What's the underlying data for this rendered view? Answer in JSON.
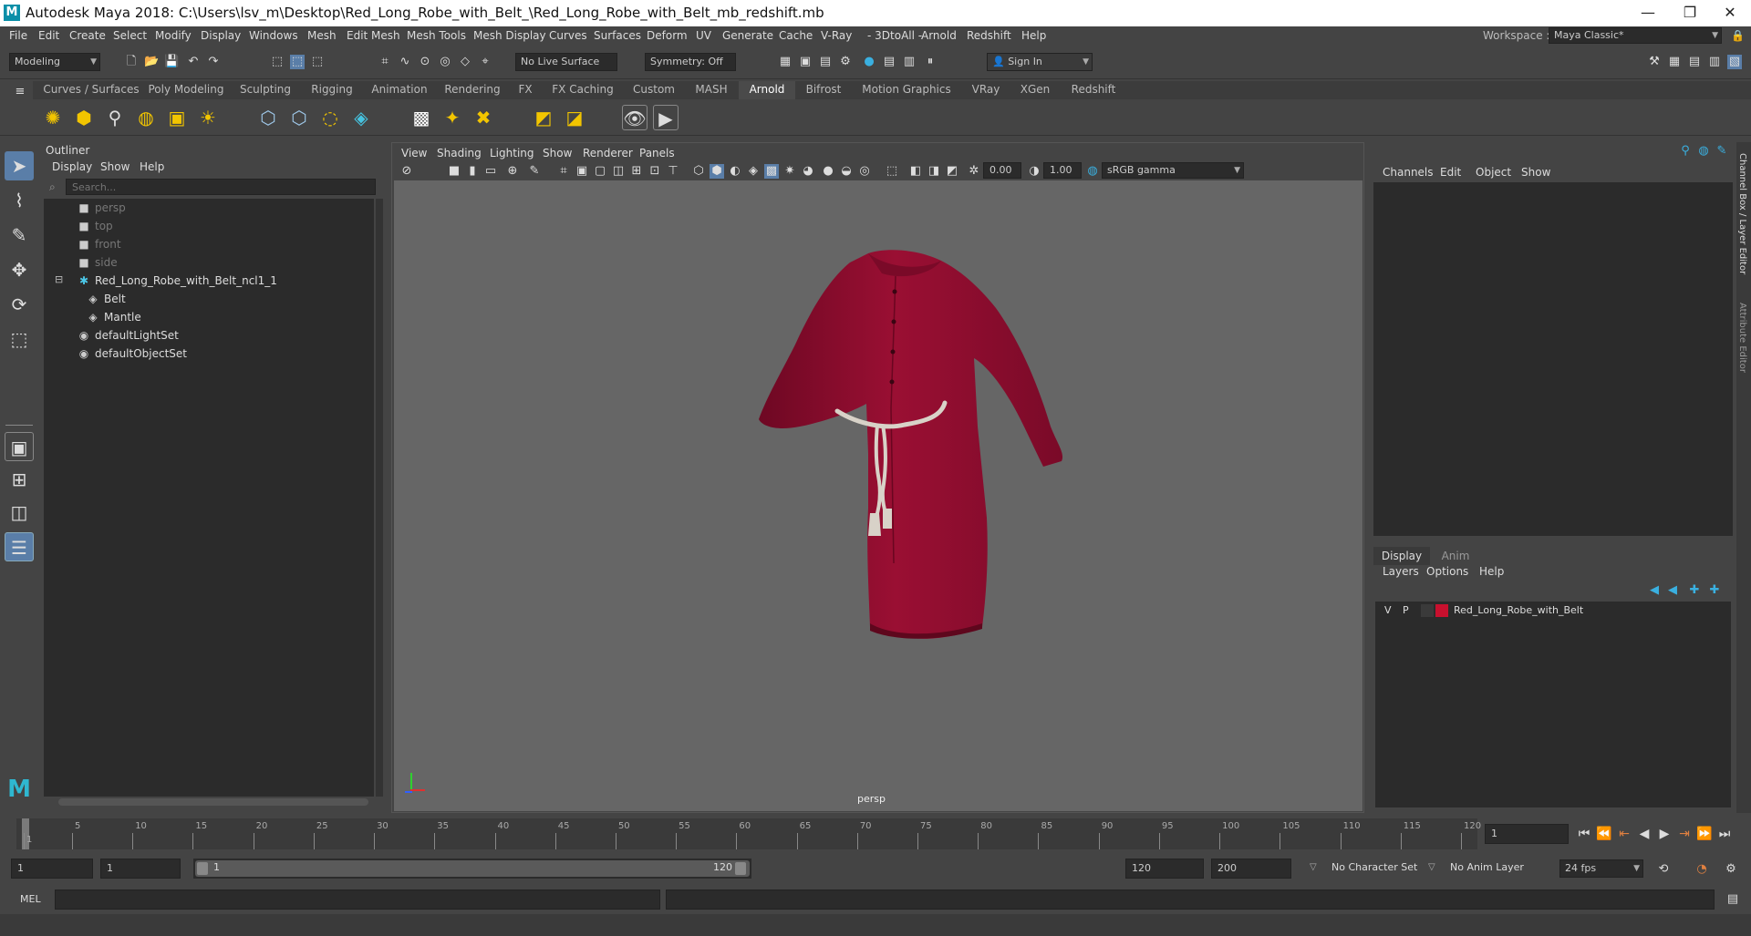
{
  "window": {
    "title": "Autodesk Maya 2018: C:\\Users\\lsv_m\\Desktop\\Red_Long_Robe_with_Belt_\\Red_Long_Robe_with_Belt_mb_redshift.mb",
    "logo_letter": "M",
    "minimize": "—",
    "maximize": "❐",
    "close": "✕"
  },
  "menubar": [
    "File",
    "Edit",
    "Create",
    "Select",
    "Modify",
    "Display",
    "Windows",
    "Mesh",
    "Edit Mesh",
    "Mesh Tools",
    "Mesh Display",
    "Curves",
    "Surfaces",
    "Deform",
    "UV",
    "Generate",
    "Cache",
    "V-Ray",
    "- 3DtoAll -",
    "Arnold",
    "Redshift",
    "Help"
  ],
  "workspace": {
    "label": "Workspace :",
    "value": "Maya Classic*"
  },
  "statusline": {
    "mode": "Modeling",
    "live_surface": "No Live Surface",
    "symmetry": "Symmetry: Off",
    "sign_in": "Sign In"
  },
  "shelf_tabs": [
    "Curves / Surfaces",
    "Poly Modeling",
    "Sculpting",
    "Rigging",
    "Animation",
    "Rendering",
    "FX",
    "FX Caching",
    "Custom",
    "MASH",
    "Arnold",
    "Bifrost",
    "Motion Graphics",
    "VRay",
    "XGen",
    "Redshift"
  ],
  "shelf_active": "Arnold",
  "outliner": {
    "title": "Outliner",
    "menu": [
      "Display",
      "Show",
      "Help"
    ],
    "search_placeholder": "Search...",
    "items": [
      {
        "label": "persp",
        "dim": true,
        "icon": "camera-icon"
      },
      {
        "label": "top",
        "dim": true,
        "icon": "camera-icon"
      },
      {
        "label": "front",
        "dim": true,
        "icon": "camera-icon"
      },
      {
        "label": "side",
        "dim": true,
        "icon": "camera-icon"
      },
      {
        "label": "Red_Long_Robe_with_Belt_ncl1_1",
        "dim": false,
        "icon": "group-icon"
      },
      {
        "label": "Belt",
        "dim": false,
        "icon": "mesh-icon"
      },
      {
        "label": "Mantle",
        "dim": false,
        "icon": "mesh-icon"
      },
      {
        "label": "defaultLightSet",
        "dim": false,
        "icon": "set-icon"
      },
      {
        "label": "defaultObjectSet",
        "dim": false,
        "icon": "set-icon"
      }
    ]
  },
  "viewport": {
    "menu": [
      "View",
      "Shading",
      "Lighting",
      "Show",
      "Renderer",
      "Panels"
    ],
    "exposure": "0.00",
    "gamma": "1.00",
    "color_space": "sRGB gamma",
    "camera_label": "persp",
    "robe_color": "#9a0f33",
    "rope_color": "#d8d2c8"
  },
  "channelbox": {
    "menu": [
      "Channels",
      "Edit",
      "Object",
      "Show"
    ],
    "side_tab1": "Channel Box / Layer Editor",
    "side_tab2": "Attribute Editor"
  },
  "layer_editor": {
    "tabs": [
      "Display",
      "Anim"
    ],
    "menu": [
      "Layers",
      "Options",
      "Help"
    ],
    "layer": {
      "v": "V",
      "p": "P",
      "name": "Red_Long_Robe_with_Belt",
      "color": "#c8102e"
    }
  },
  "timeslider": {
    "ticks": [
      "1",
      "5",
      "10",
      "15",
      "20",
      "25",
      "30",
      "35",
      "40",
      "45",
      "50",
      "55",
      "60",
      "65",
      "70",
      "75",
      "80",
      "85",
      "90",
      "95",
      "100",
      "105",
      "110",
      "115",
      "120"
    ],
    "current_frame": "1",
    "current_fraction": 0
  },
  "range": {
    "start": "1",
    "playback_start": "1",
    "slider_start": "1",
    "slider_end": "120",
    "playback_end": "120",
    "end": "200",
    "character_set": "No Character Set",
    "anim_layer": "No Anim Layer",
    "fps": "24 fps"
  },
  "cmdline": {
    "label": "MEL"
  }
}
